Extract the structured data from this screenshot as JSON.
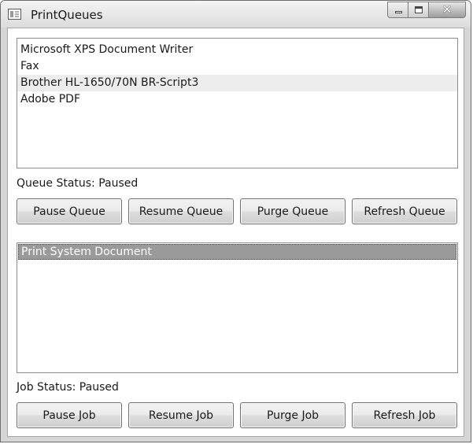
{
  "window": {
    "title": "PrintQueues",
    "icons": {
      "app": "window-app-icon",
      "minimize": "minimize-icon",
      "maximize": "maximize-icon",
      "close": "close-icon"
    },
    "close_glyph": "✕"
  },
  "queues": {
    "items": [
      "Microsoft XPS Document Writer",
      "Fax",
      "Brother HL-1650/70N BR-Script3",
      "Adobe PDF"
    ],
    "status_text": "Queue Status: Paused",
    "buttons": {
      "pause": "Pause Queue",
      "resume": "Resume Queue",
      "purge": "Purge Queue",
      "refresh": "Refresh Queue"
    }
  },
  "jobs": {
    "items": [
      "Print System Document"
    ],
    "status_text": "Job Status: Paused",
    "buttons": {
      "pause": "Pause Job",
      "resume": "Resume Job",
      "purge": "Purge Job",
      "refresh": "Refresh Job"
    }
  },
  "colors": {
    "selected_row": "#9a9a9a",
    "hover_row": "#ededed",
    "window_frame": "#d6d6d6"
  }
}
